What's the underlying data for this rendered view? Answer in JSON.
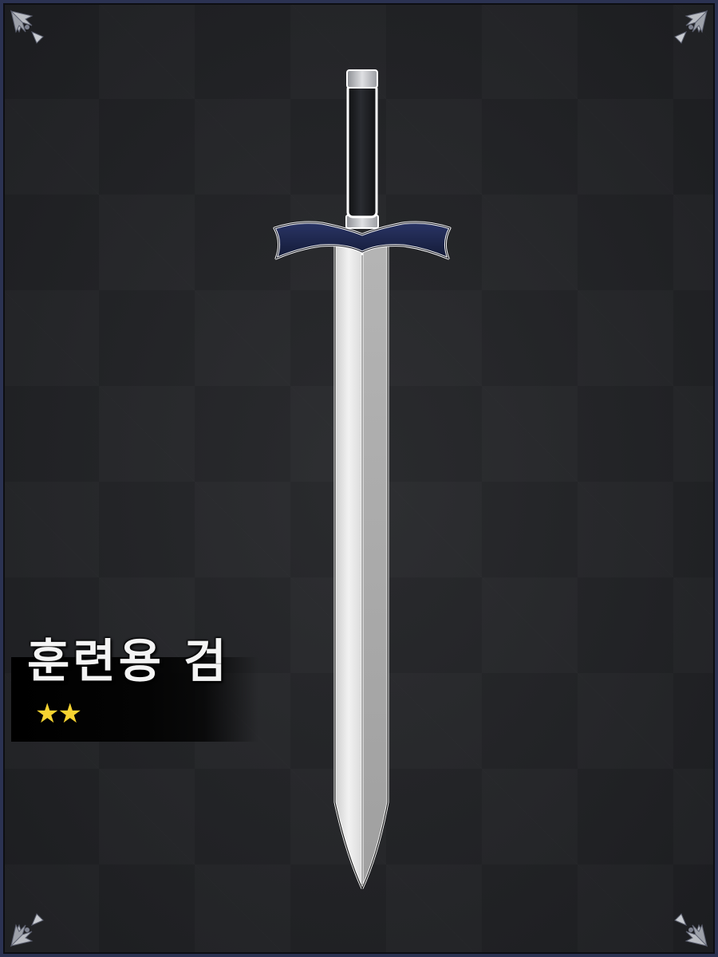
{
  "item": {
    "name": "훈련용 검",
    "rating": "★★",
    "stars": 2
  },
  "colors": {
    "frame_border": "#2b3252",
    "background": "#232426",
    "guard": "#1e2647",
    "grip": "#17181b",
    "blade_light": "#e6e6e6",
    "blade_dark": "#a9a9a9",
    "star": "#f7d431"
  },
  "icons": {
    "corner_ornament": "fleur-corner-icon",
    "weapon": "sword-icon"
  }
}
